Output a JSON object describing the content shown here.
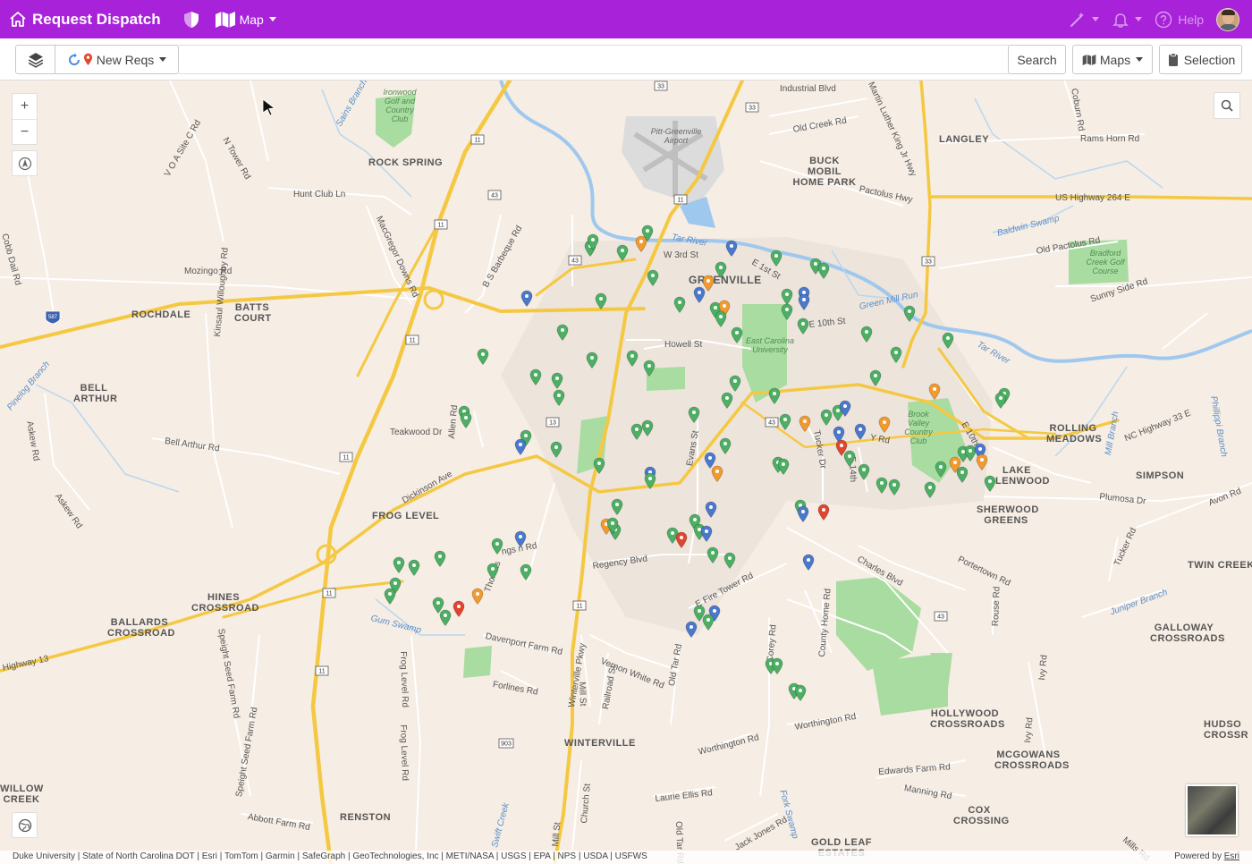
{
  "app": {
    "title": "Request Dispatch",
    "map_menu_label": "Map",
    "help_label": "Help",
    "brand_color": "#a822d9"
  },
  "toolbar": {
    "new_reqs_label": "New Reqs",
    "search_value": "",
    "search_button": "Search",
    "maps_button": "Maps",
    "selection_button": "Selection"
  },
  "map": {
    "zoom_in": "+",
    "zoom_out": "−",
    "attribution": "Duke University | State of North Carolina DOT | Esri | TomTom | Garmin | SafeGraph | GeoTechnologies, Inc | METI/NASA | USGS | EPA | NPS | USDA | USFWS",
    "powered_by_prefix": "Powered by ",
    "powered_by_link": "Esri",
    "labels": {
      "rock_spring": "ROCK SPRING",
      "rochdale": "ROCHDALE",
      "batts_court": "BATTS COURT",
      "bell_arthur": "BELL ARTHUR",
      "frog_level": "FROG LEVEL",
      "hines_crossroad": "HINES CROSSROAD",
      "ballards_crossroad": "BALLARDS CROSSROAD",
      "renston": "RENSTON",
      "willow_creek": "WILLOW CREEK",
      "winterville": "WINTERVILLE",
      "greenville": "GREENVILLE",
      "buck_mobil": "BUCK MOBIL HOME PARK",
      "langley": "LANGLEY",
      "rolling_meadows": "ROLLING MEADOWS",
      "lake_glenwood": "LAKE GLENWOOD",
      "simpson": "SIMPSON",
      "sherwood_greens": "SHERWOOD GREENS",
      "twin_creek": "TWIN CREEK",
      "galloway": "GALLOWAY CROSSROADS",
      "hollywood": "HOLLYWOOD CROSSROADS",
      "mcgowans": "MCGOWANS CROSSROADS",
      "cox_crossing": "COX CROSSING",
      "gold_leaf": "GOLD LEAF ESTATES",
      "hudson": "HUDSO CROSSR",
      "industrial_blvd": "Industrial Blvd",
      "old_creek_rd": "Old Creek Rd",
      "pactolus_hwy": "Pactolus Hwy",
      "us264": "US Highway 264 E",
      "rams_horn": "Rams Horn Rd",
      "mlk": "Martin Luther King Jr Hwy",
      "hunt_club": "Hunt Club Ln",
      "mozingo": "Mozingo Rd",
      "teakwood": "Teakwood Dr",
      "bell_arthur_rd": "Bell Arthur Rd",
      "dickinson": "Dickinson Ave",
      "regency": "Regency Blvd",
      "fire_tower": "E Fire Tower Rd",
      "charles": "Charles Blvd",
      "davenport": "Davenport Farm Rd",
      "forlines": "Forlines Rd",
      "vernon_white": "Vernon White Rd",
      "worthington1": "Worthington Rd",
      "worthington2": "Worthington Rd",
      "edwards_farm": "Edwards Farm Rd",
      "manning": "Manning Rd",
      "laurie_ellis": "Laurie Ellis Rd",
      "jack_jones": "Jack Jones Rd",
      "abbott_farm": "Abbott Farm Rd",
      "highway13": "Highway 13",
      "nc33": "NC Highway 33 E",
      "plumosa": "Plumosa Dr",
      "avon": "Avon Rd",
      "portertown": "Portertown Rd",
      "old_pactolus": "Old Pactolus Rd",
      "sunny_side": "Sunny Side Rd",
      "w3rd": "W 3rd St",
      "e1st": "E 1st St",
      "e10th": "E 10th St",
      "howell": "Howell St",
      "evans": "Evans St",
      "tar_river": "Tar River",
      "tar_river2": "Tar River",
      "green_mill": "Green Mill Run",
      "baldwin": "Baldwin Swamp",
      "gum_swamp": "Gum Swamp",
      "sains_branch": "Sains Branch",
      "juniper": "Juniper Branch",
      "pinelog": "Pinelog Branch",
      "ecu": "East Carolina University",
      "ironwood": "Ironwood Golf and Country Club",
      "brook_valley": "Brook Valley Country Club",
      "bradford": "Bradford Creek Golf Course",
      "airport": "Pitt-Greenville Airport",
      "cobb_dail": "Cobb Dail Rd",
      "askew1": "Askew Rd",
      "askew2": "Askew Rd",
      "kinsaul": "Kinsaul Willoughby Rd",
      "allen": "Allen Rd",
      "macgregor": "MacGregor Downs Rd",
      "bs_barbeque": "B S Barbeque Rd",
      "n_tower": "N Tower Rd",
      "voa": "V O A Site C Rd",
      "thomas": "Thomas",
      "langston": "Langston Rd",
      "frog_level_rd": "Frog Level Rd",
      "frog_level_rd2": "Frog Level Rd",
      "mill_st": "Mill St",
      "railroad": "Railroad St",
      "old_tar": "Old Tar Rd",
      "old_tar2": "Old Tar Rd",
      "corey": "Corey Rd",
      "county_home": "County Home Rd",
      "rouse": "Rouse Rd",
      "tucker_dr": "Tucker Dr",
      "e10th_st": "E 10th St",
      "church": "Church St",
      "speight1": "Speight Seed Farm Rd",
      "speight2": "Speight Seed Farm Rd",
      "tucker_rd": "Tucker Rd",
      "ivy": "Ivy Rd",
      "ivy2": "Ivy Rd",
      "winterville_pkwy": "Winterville Pkwy",
      "coburn": "Coburn Rd",
      "swift_creek": "Swift Creek",
      "fork_swamp": "Fork Swamp",
      "mill_branch": "Mill Branch",
      "phillippi": "Phillippi Branch",
      "mills_rd": "Mills Rd",
      "mill_st2": "Mill St",
      "e14th": "E 14th",
      "york_rd": "Y  Rd",
      "rd_ng": "ngs  n Rd"
    },
    "shields": [
      "33",
      "33",
      "11",
      "43",
      "11",
      "43",
      "11",
      "13",
      "11",
      "43",
      "11",
      "33",
      "11",
      "11",
      "903",
      "43",
      "587",
      "11"
    ]
  }
}
